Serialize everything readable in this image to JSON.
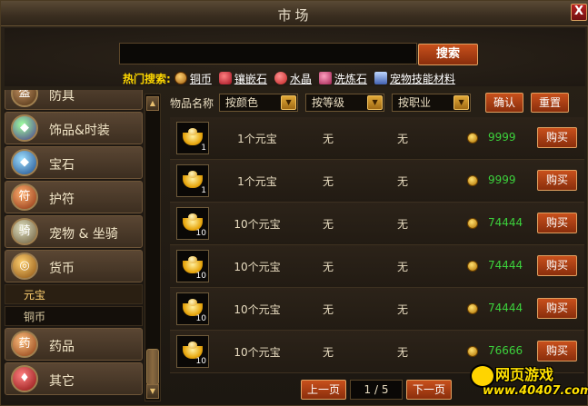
{
  "window": {
    "title": "市场",
    "close_label": "X"
  },
  "search": {
    "value": "",
    "button_label": "搜索",
    "hot_label": "热门搜索:",
    "hot_items": [
      {
        "label": "铜币",
        "icon": "copper-coin-icon",
        "color": "#d08a20"
      },
      {
        "label": "镶嵌石",
        "icon": "red-gem-icon",
        "color": "#d02030"
      },
      {
        "label": "水晶",
        "icon": "crystal-icon",
        "color": "#e04040"
      },
      {
        "label": "洗炼石",
        "icon": "refine-stone-icon",
        "color": "#c83050"
      },
      {
        "label": "宠物技能材料",
        "icon": "pet-skill-book-icon",
        "color": "#7090d0"
      }
    ]
  },
  "sidebar": {
    "categories": [
      {
        "label": "防具",
        "icon": "armor-icon"
      },
      {
        "label": "饰品&时装",
        "icon": "accessory-icon"
      },
      {
        "label": "宝石",
        "icon": "gem-icon"
      },
      {
        "label": "护符",
        "icon": "amulet-icon"
      },
      {
        "label": "宠物 & 坐骑",
        "icon": "pet-mount-icon"
      },
      {
        "label": "货币",
        "icon": "currency-icon"
      },
      {
        "label": "药品",
        "icon": "medicine-icon"
      },
      {
        "label": "其它",
        "icon": "other-icon"
      }
    ],
    "subcategories": [
      {
        "label": "元宝",
        "active": true
      },
      {
        "label": "铜币",
        "active": false
      }
    ]
  },
  "filters": {
    "item_name_label": "物品名称",
    "color_dropdown": "按颜色",
    "level_dropdown": "按等级",
    "class_dropdown": "按职业",
    "confirm_label": "确认",
    "reset_label": "重置"
  },
  "listings": [
    {
      "name": "1个元宝",
      "qty": "1",
      "col2": "无",
      "col3": "无",
      "price": "9999",
      "buy_label": "购买"
    },
    {
      "name": "1个元宝",
      "qty": "1",
      "col2": "无",
      "col3": "无",
      "price": "9999",
      "buy_label": "购买"
    },
    {
      "name": "10个元宝",
      "qty": "10",
      "col2": "无",
      "col3": "无",
      "price": "74444",
      "buy_label": "购买"
    },
    {
      "name": "10个元宝",
      "qty": "10",
      "col2": "无",
      "col3": "无",
      "price": "74444",
      "buy_label": "购买"
    },
    {
      "name": "10个元宝",
      "qty": "10",
      "col2": "无",
      "col3": "无",
      "price": "74444",
      "buy_label": "购买"
    },
    {
      "name": "10个元宝",
      "qty": "10",
      "col2": "无",
      "col3": "无",
      "price": "76666",
      "buy_label": "购买"
    }
  ],
  "pager": {
    "prev_label": "上一页",
    "page_indicator": "1 / 5",
    "next_label": "下一页"
  },
  "watermark": {
    "top": "网页游戏",
    "bottom": "www.40407.com"
  }
}
